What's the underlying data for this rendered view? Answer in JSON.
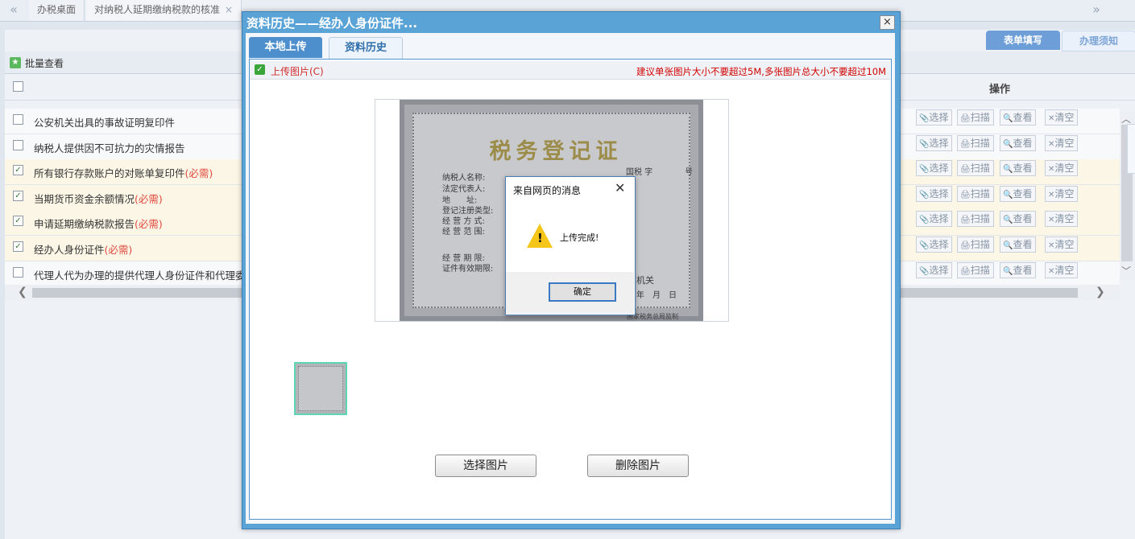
{
  "top_tabs": {
    "prev_icon": "«",
    "next_icon": "»",
    "tabs": [
      {
        "label": "办税桌面"
      },
      {
        "label": "对纳税人延期缴纳税款的核准",
        "close": "×"
      }
    ]
  },
  "right_tabs": [
    "表单填写",
    "办理须知"
  ],
  "batch": {
    "label": "批量查看"
  },
  "table": {
    "op_header": "操作",
    "rows": [
      {
        "label": "公安机关出具的事故证明复印件",
        "required": "",
        "checked": false
      },
      {
        "label": "纳税人提供因不可抗力的灾情报告",
        "required": "",
        "checked": false
      },
      {
        "label": "所有银行存款账户的对账单复印件",
        "required": "(必需)",
        "checked": true
      },
      {
        "label": "当期货币资金余额情况",
        "required": "(必需)",
        "checked": true
      },
      {
        "label": "申请延期缴纳税款报告",
        "required": "(必需)",
        "checked": true
      },
      {
        "label": "经办人身份证件",
        "required": "(必需)",
        "checked": true
      },
      {
        "label": "代理人代为办理的提供代理人身份证件和代理委托",
        "required": "",
        "checked": false
      }
    ],
    "op_buttons": {
      "select": "选择",
      "scan": "扫描",
      "view": "查看",
      "clear": "清空"
    }
  },
  "dialog": {
    "title": "资料历史——经办人身份证件...",
    "close": "×",
    "tabs": [
      "本地上传",
      "资料历史"
    ],
    "upload_label": "上传图片(C)",
    "hint": "建议单张图片大小不要超过5M,多张图片总大小不要超过10M",
    "certificate": {
      "title": "税务登记证",
      "fields": [
        "纳税人名称:",
        "法定代表人:",
        "地　　址:",
        "登记注册类型:",
        "经 营 方 式:",
        "经 营 范 围:",
        "经 营 期 限:",
        "证件有效期限:"
      ],
      "top_right": "国税 字　　　　号",
      "issuer": "机关",
      "date": "年　月　日",
      "footer": "国家税务总局监制"
    },
    "buttons": {
      "choose": "选择图片",
      "delete": "删除图片"
    }
  },
  "alert": {
    "title": "来自网页的消息",
    "close": "✕",
    "message": "上传完成!",
    "ok": "确定"
  },
  "colors": {
    "accent": "#5aa3d7",
    "required": "#e04a3f",
    "hint": "#d10000"
  }
}
